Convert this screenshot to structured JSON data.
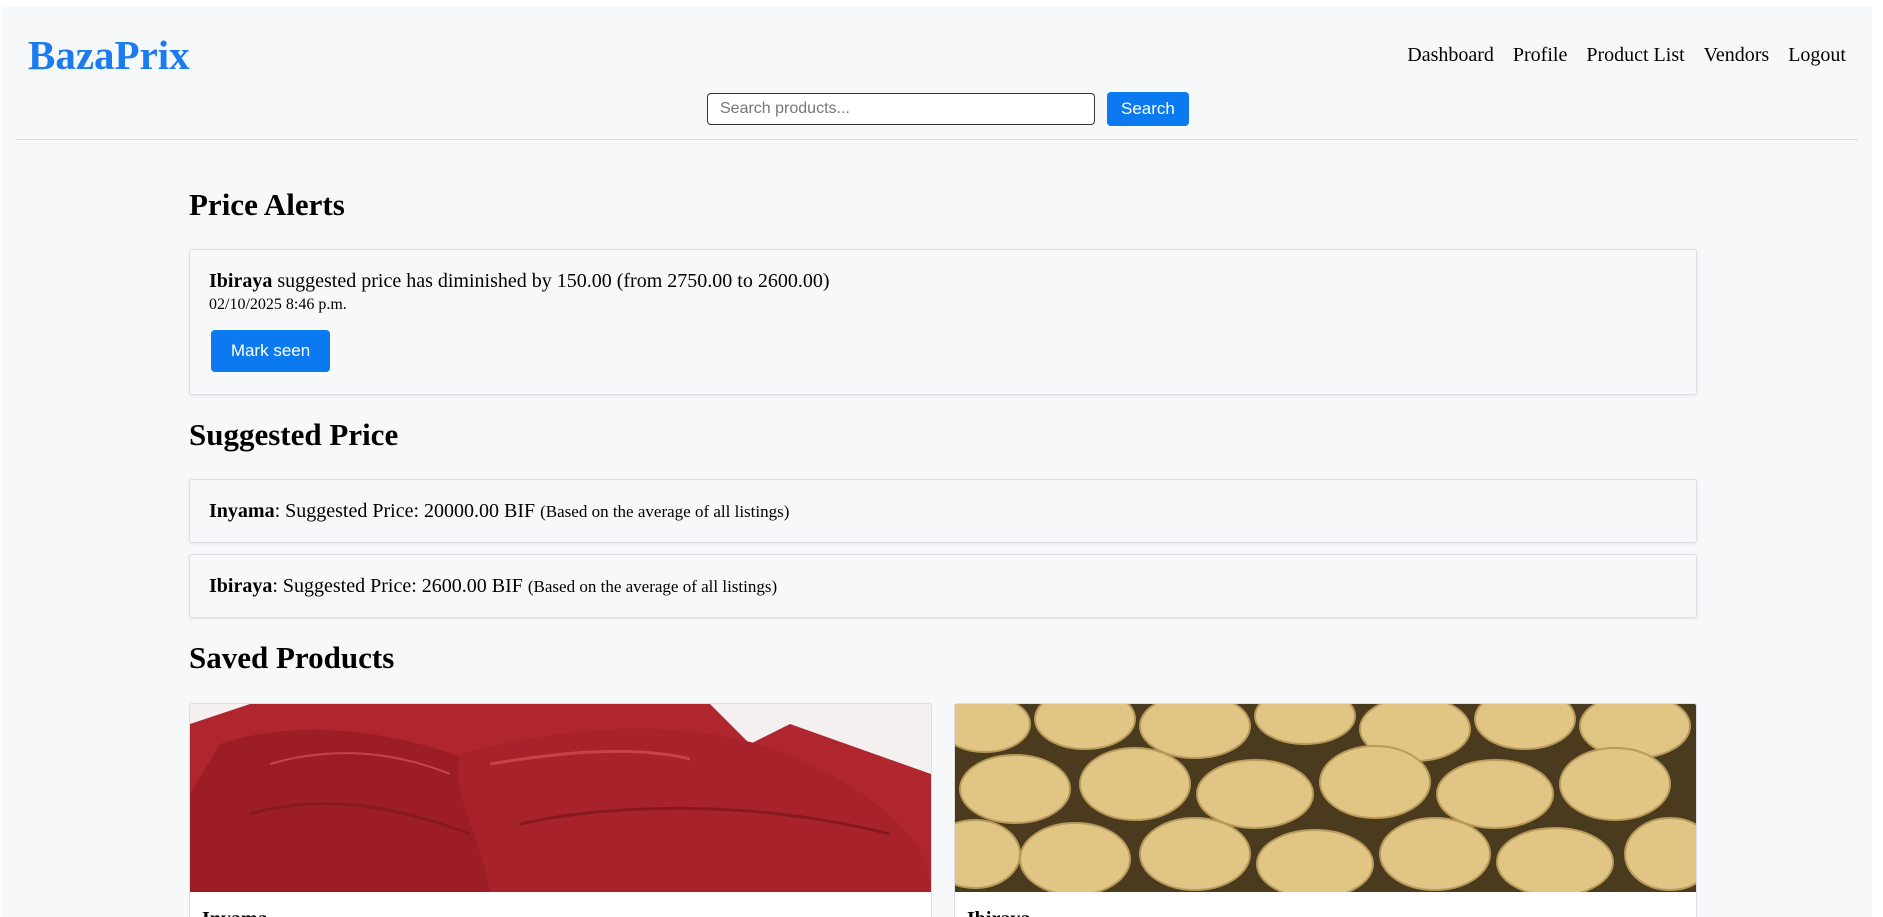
{
  "header": {
    "brand": "BazaPrix",
    "nav": [
      "Dashboard",
      "Profile",
      "Product List",
      "Vendors",
      "Logout"
    ],
    "search_placeholder": "Search products...",
    "search_value": "",
    "search_button": "Search"
  },
  "alerts": {
    "title": "Price Alerts",
    "items": [
      {
        "product": "Ibiraya",
        "message": " suggested price has diminished by 150.00 (from 2750.00 to 2600.00)",
        "time": "02/10/2025 8:46 p.m.",
        "button": "Mark seen"
      }
    ]
  },
  "suggested": {
    "title": "Suggested Price",
    "items": [
      {
        "product": "Inyama",
        "text": ": Suggested Price: 20000.00 BIF ",
        "note": "(Based on the average of all listings)"
      },
      {
        "product": "Ibiraya",
        "text": ": Suggested Price: 2600.00 BIF ",
        "note": "(Based on the average of all listings)"
      }
    ]
  },
  "saved": {
    "title": "Saved Products",
    "items": [
      {
        "name": "Inyama",
        "image": "raw-meat-photo"
      },
      {
        "name": "Ibiraya",
        "image": "potatoes-photo"
      }
    ]
  },
  "colors": {
    "brand": "#1a7cf0",
    "button": "#0b7af0",
    "background": "#f7f8fa"
  }
}
